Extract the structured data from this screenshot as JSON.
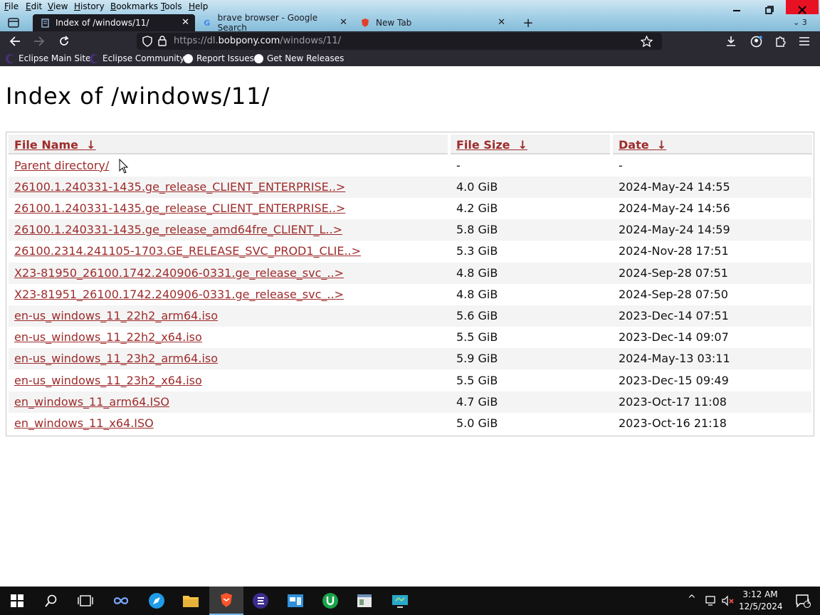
{
  "menu": [
    "File",
    "Edit",
    "View",
    "History",
    "Bookmarks",
    "Tools",
    "Help"
  ],
  "tabs": [
    {
      "title": "Index of /windows/11/",
      "active": true
    },
    {
      "title": "brave browser - Google Search",
      "active": false
    },
    {
      "title": "New Tab",
      "active": false
    }
  ],
  "tab_overflow_count": "3",
  "address": {
    "prefix": "https://dl.",
    "domain": "bobpony.com",
    "path": "/windows/11/"
  },
  "bookmarks": [
    "Eclipse Main Site",
    "Eclipse Community",
    "Report Issues",
    "Get New Releases"
  ],
  "page": {
    "title": "Index of /windows/11/",
    "columns": {
      "name": "File Name",
      "size": "File Size",
      "date": "Date",
      "sort_arrow": "↓"
    },
    "rows": [
      {
        "name": "Parent directory/",
        "size": "-",
        "date": "-"
      },
      {
        "name": "26100.1.240331-1435.ge_release_CLIENT_ENTERPRISE..>",
        "size": "4.0 GiB",
        "date": "2024-May-24 14:55"
      },
      {
        "name": "26100.1.240331-1435.ge_release_CLIENT_ENTERPRISE..>",
        "size": "4.2 GiB",
        "date": "2024-May-24 14:56"
      },
      {
        "name": "26100.1.240331-1435.ge_release_amd64fre_CLIENT_L..>",
        "size": "5.8 GiB",
        "date": "2024-May-24 14:59"
      },
      {
        "name": "26100.2314.241105-1703.GE_RELEASE_SVC_PROD1_CLIE..>",
        "size": "5.3 GiB",
        "date": "2024-Nov-28 17:51"
      },
      {
        "name": "X23-81950_26100.1742.240906-0331.ge_release_svc_..>",
        "size": "4.8 GiB",
        "date": "2024-Sep-28 07:51"
      },
      {
        "name": "X23-81951_26100.1742.240906-0331.ge_release_svc_..>",
        "size": "4.8 GiB",
        "date": "2024-Sep-28 07:50"
      },
      {
        "name": "en-us_windows_11_22h2_arm64.iso",
        "size": "5.6 GiB",
        "date": "2023-Dec-14 07:51"
      },
      {
        "name": "en-us_windows_11_22h2_x64.iso",
        "size": "5.5 GiB",
        "date": "2023-Dec-14 09:07"
      },
      {
        "name": "en-us_windows_11_23h2_arm64.iso",
        "size": "5.9 GiB",
        "date": "2024-May-13 03:11"
      },
      {
        "name": "en-us_windows_11_23h2_x64.iso",
        "size": "5.5 GiB",
        "date": "2023-Dec-15 09:49"
      },
      {
        "name": "en_windows_11_arm64.ISO",
        "size": "4.7 GiB",
        "date": "2023-Oct-17 11:08"
      },
      {
        "name": "en_windows_11_x64.ISO",
        "size": "5.0 GiB",
        "date": "2023-Oct-16 21:18"
      }
    ]
  },
  "taskbar": {
    "time": "3:12 AM",
    "date": "12/5/2024",
    "notification_count": "1"
  },
  "colors": {
    "link": "#9e2b2b",
    "accent": "#76b9ed"
  }
}
